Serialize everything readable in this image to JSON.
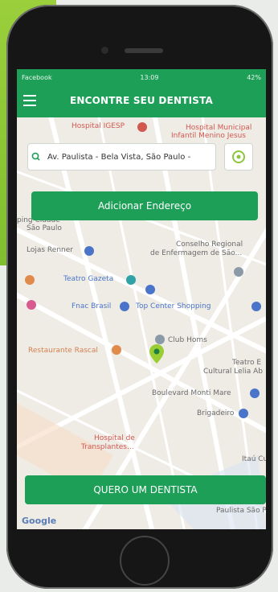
{
  "status_bar": {
    "left": "Facebook",
    "time": "13:09",
    "right": "42%"
  },
  "header": {
    "title": "ENCONTRE SEU DENTISTA"
  },
  "search": {
    "value": "Av. Paulista - Bela Vista, São Paulo -",
    "placeholder": ""
  },
  "buttons": {
    "add_address": "Adicionar Endereço",
    "cta": "QUERO UM DENTISTA"
  },
  "map": {
    "labels": {
      "hospital_igesp": "Hospital IGESP",
      "hospital_municipal": "Hospital Municipal",
      "infantil": "Infantil Menino Jesus",
      "cidade": "ping Cidade",
      "sao_paulo": "São Paulo",
      "lojas_renner": "Lojas Renner",
      "conselho": "Conselho Regional",
      "enfermagem": "de Enfermagem de São...",
      "teatro_gazeta": "Teatro Gazeta",
      "fnac": "Fnac Brasil",
      "top_center": "Top Center Shopping",
      "restaurante": "Restaurante Rascal",
      "club_homs": "Club Homs",
      "teatro_e": "Teatro E",
      "cultural": "Cultural Lelia Ab",
      "boulevard": "Boulevard Monti Mare",
      "brigadeiro": "Brigadeiro",
      "hospital_trans": "Hospital de",
      "transplantes": "Transplantes...",
      "itau": "Itaú Cu",
      "paulista_sao_paul": "Paulista São Paul",
      "google": "Google"
    }
  },
  "colors": {
    "brand_green": "#1d9f57",
    "accent_lime": "#8cc63f"
  }
}
